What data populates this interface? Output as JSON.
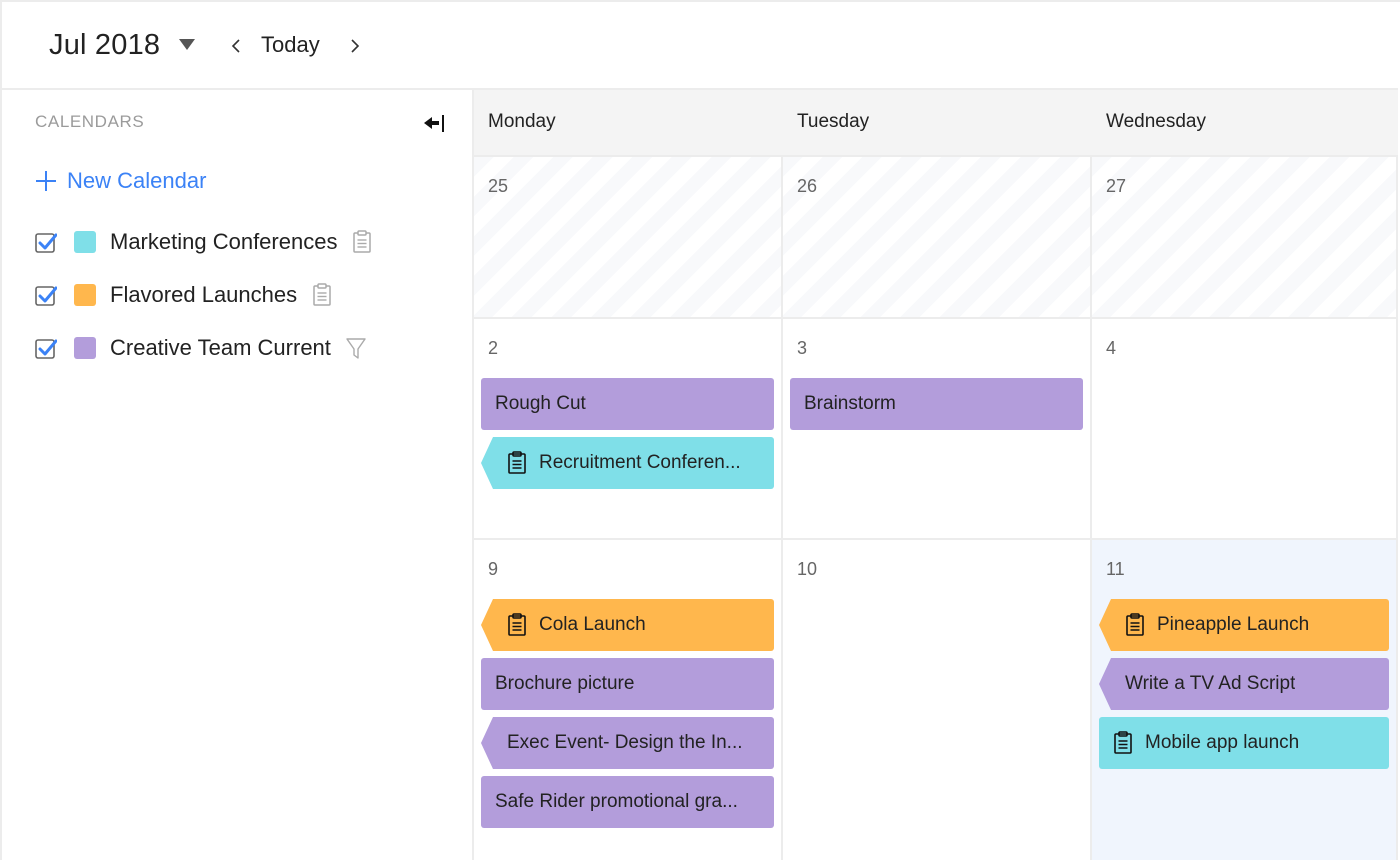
{
  "header": {
    "month_label": "Jul 2018",
    "today_label": "Today"
  },
  "sidebar": {
    "title": "CALENDARS",
    "new_calendar_label": "New Calendar",
    "calendars": [
      {
        "name": "Marketing Conferences",
        "checked": true,
        "color": "#7fdfe8",
        "action_icon": "clipboard-icon"
      },
      {
        "name": "Flavored Launches",
        "checked": true,
        "color": "#ffb74d",
        "action_icon": "clipboard-icon"
      },
      {
        "name": "Creative Team Current",
        "checked": true,
        "color": "#b39ddb",
        "action_icon": "filter-icon"
      }
    ]
  },
  "colors": {
    "accent": "#3b82f6",
    "marketing": "#7fdfe8",
    "launches": "#ffb74d",
    "creative": "#b39ddb",
    "today_bg": "#f0f5fd"
  },
  "calendar": {
    "weekdays": [
      "Monday",
      "Tuesday",
      "Wednesday"
    ],
    "weeks": [
      {
        "days": [
          {
            "num": "25",
            "past": true,
            "today": false,
            "events": []
          },
          {
            "num": "26",
            "past": true,
            "today": false,
            "events": []
          },
          {
            "num": "27",
            "past": true,
            "today": false,
            "events": []
          }
        ]
      },
      {
        "days": [
          {
            "num": "2",
            "past": false,
            "today": false,
            "events": [
              {
                "title": "Rough Cut",
                "color": "purple",
                "continued": false,
                "icon": false
              },
              {
                "title": "Recruitment Conferen...",
                "color": "cyan",
                "continued": true,
                "icon": true
              }
            ]
          },
          {
            "num": "3",
            "past": false,
            "today": false,
            "events": [
              {
                "title": "Brainstorm",
                "color": "purple",
                "continued": false,
                "icon": false
              }
            ]
          },
          {
            "num": "4",
            "past": false,
            "today": false,
            "events": []
          }
        ]
      },
      {
        "days": [
          {
            "num": "9",
            "past": false,
            "today": false,
            "events": [
              {
                "title": "Cola Launch",
                "color": "orange",
                "continued": true,
                "icon": true
              },
              {
                "title": "Brochure picture",
                "color": "purple",
                "continued": false,
                "icon": false
              },
              {
                "title": "Exec Event- Design the In...",
                "color": "purple",
                "continued": true,
                "icon": false
              },
              {
                "title": "Safe Rider promotional gra...",
                "color": "purple",
                "continued": false,
                "icon": false
              }
            ]
          },
          {
            "num": "10",
            "past": false,
            "today": false,
            "events": []
          },
          {
            "num": "11",
            "past": false,
            "today": true,
            "events": [
              {
                "title": "Pineapple Launch",
                "color": "orange",
                "continued": true,
                "icon": true
              },
              {
                "title": "Write a TV Ad Script",
                "color": "purple",
                "continued": true,
                "icon": false
              },
              {
                "title": "Mobile app launch",
                "color": "cyan",
                "continued": false,
                "icon": true
              }
            ]
          }
        ]
      }
    ]
  }
}
